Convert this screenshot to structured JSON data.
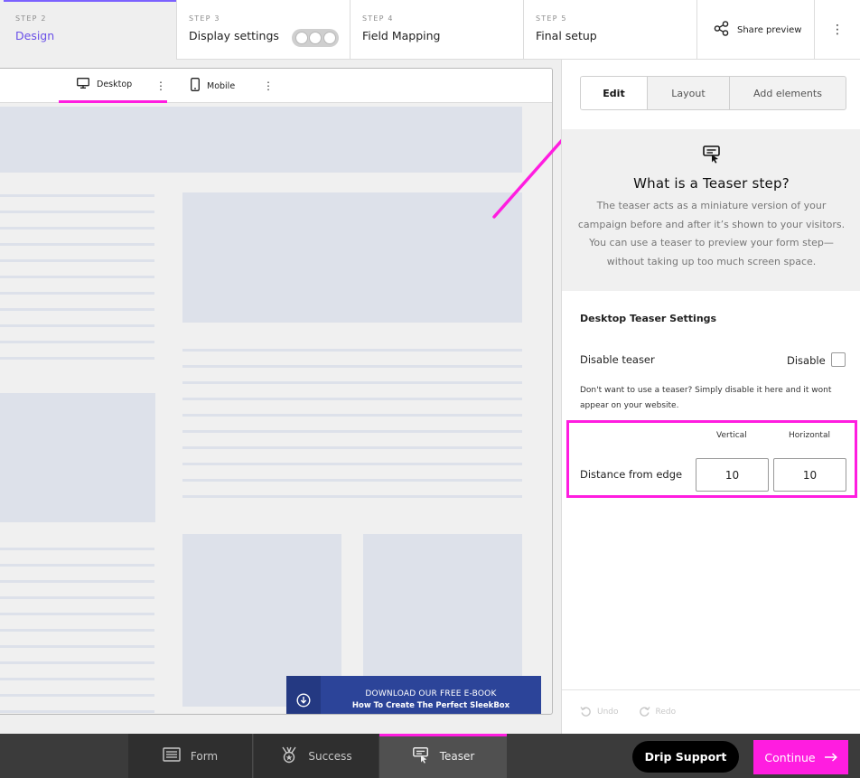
{
  "steps": [
    {
      "num": "STEP 2",
      "title": "Design"
    },
    {
      "num": "STEP 3",
      "title": "Display settings"
    },
    {
      "num": "STEP 4",
      "title": "Field Mapping"
    },
    {
      "num": "STEP 5",
      "title": "Final setup"
    }
  ],
  "header": {
    "share_label": "Share preview",
    "more_icon": "kebab-vertical-icon"
  },
  "preview": {
    "devices": [
      {
        "label": "Desktop",
        "icon": "desktop-monitor-icon",
        "active": true
      },
      {
        "label": "Mobile",
        "icon": "mobile-phone-icon",
        "active": false
      }
    ],
    "teaser_banner": {
      "line1": "DOWNLOAD OUR FREE E-BOOK",
      "line2": "How To Create The Perfect SleekBox",
      "icon": "download-circle-icon"
    }
  },
  "panel": {
    "tabs": [
      {
        "label": "Edit",
        "active": true
      },
      {
        "label": "Layout",
        "active": false
      },
      {
        "label": "Add elements",
        "active": false
      }
    ],
    "info": {
      "icon": "teaser-icon",
      "title": "What is a Teaser step?",
      "body": "The teaser acts as a miniature version of your campaign before and after it’s shown to your visitors. You can use a teaser to preview your form step—without taking up too much screen space."
    },
    "section_title": "Desktop Teaser Settings",
    "disable_teaser": {
      "label": "Disable teaser",
      "checkbox_label": "Disable",
      "checked": false,
      "hint": "Don't want to use a teaser? Simply disable it here and it wont appear on your website."
    },
    "distance": {
      "label": "Distance from edge",
      "vertical_label": "Vertical",
      "horizontal_label": "Horizontal",
      "vertical_value": "10",
      "horizontal_value": "10"
    },
    "undo_label": "Undo",
    "redo_label": "Redo"
  },
  "bottom": {
    "tabs": [
      {
        "label": "Form",
        "icon": "form-icon",
        "active": false
      },
      {
        "label": "Success",
        "icon": "success-badge-icon",
        "active": false
      },
      {
        "label": "Teaser",
        "icon": "teaser-icon",
        "active": true
      }
    ],
    "support_label": "Drip Support",
    "continue_label": "Continue"
  },
  "colors": {
    "accent_magenta": "#ff1de0",
    "step_active_purple": "#6a50e8",
    "banner_blue": "#2c4499"
  }
}
